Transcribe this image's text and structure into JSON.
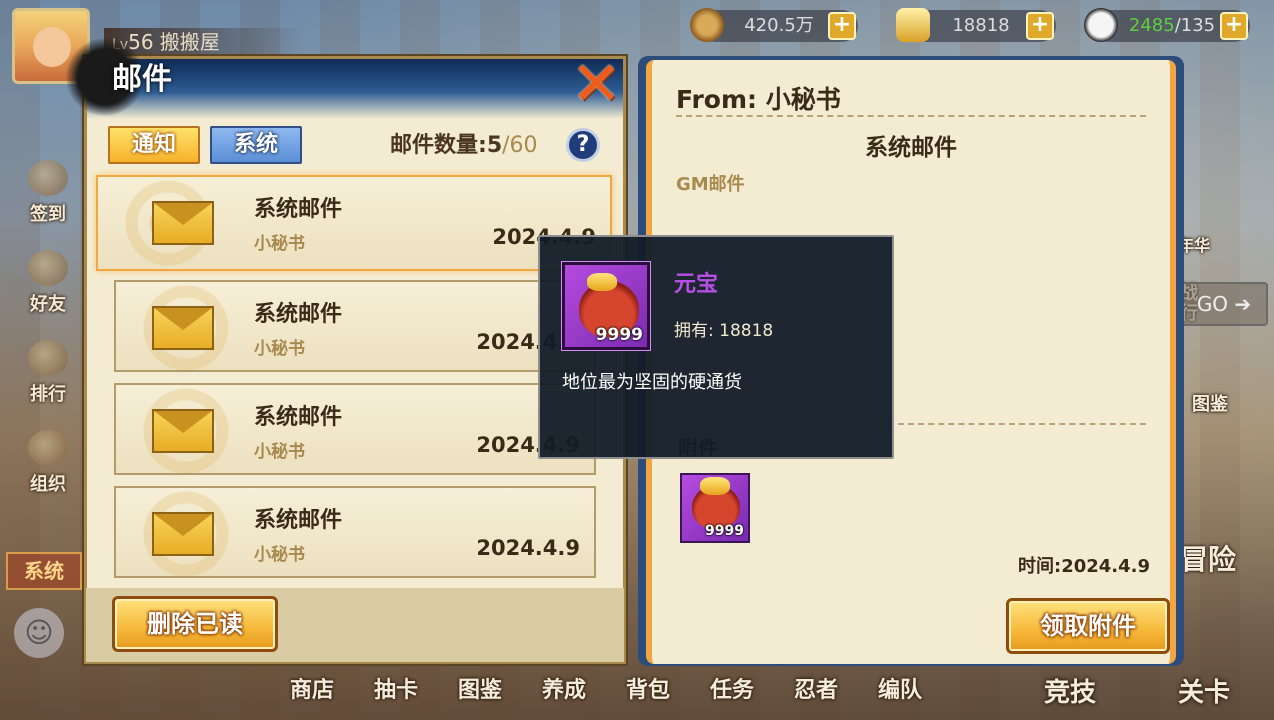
{
  "topbar": {
    "level_prefix": "Lv",
    "level": "56",
    "player_name": "搬搬屋",
    "coins": "420.5万",
    "gold": "18818",
    "stamina_current": "2485",
    "stamina_max": "/135",
    "plus": "+"
  },
  "side_menu": [
    "签到",
    "好友",
    "排行",
    "组织"
  ],
  "side_system": "系统",
  "bottom_nav": [
    "商店",
    "抽卡",
    "图鉴",
    "养成",
    "背包",
    "任务",
    "忍者",
    "编队"
  ],
  "bottom_big": [
    "竞技",
    "关卡"
  ],
  "right_menu": {
    "rebate": "年华",
    "battle": "战\n行",
    "go": "GO ➔",
    "gallery": "图鉴",
    "adventure": "冒险"
  },
  "mail": {
    "title": "邮件",
    "close": "✕",
    "tab_notice": "通知",
    "tab_system": "系统",
    "count_label": "邮件数量:",
    "count_current": "5",
    "count_max": "/60",
    "help": "?",
    "items": [
      {
        "title": "系统邮件",
        "from": "小秘书",
        "date": "2024.4.9"
      },
      {
        "title": "系统邮件",
        "from": "小秘书",
        "date": "2024.4.9"
      },
      {
        "title": "系统邮件",
        "from": "小秘书",
        "date": "2024.4.9"
      },
      {
        "title": "系统邮件",
        "from": "小秘书",
        "date": "2024.4.9"
      }
    ],
    "delete_read": "删除已读"
  },
  "detail": {
    "from": "From: 小秘书",
    "subject": "系统邮件",
    "body": "GM邮件",
    "attachment_label": "附件",
    "attachment_qty": "9999",
    "time": "时间:2024.4.9",
    "claim": "领取附件"
  },
  "tooltip": {
    "name": "元宝",
    "owned": "拥有: 18818",
    "qty": "9999",
    "description": "地位最为坚固的硬通货"
  },
  "colors": {
    "panel_bg": "#f3ecd3",
    "gold_button": "#f6b83a",
    "item_purple": "#b54be0",
    "tooltip_name": "#b650e6"
  }
}
